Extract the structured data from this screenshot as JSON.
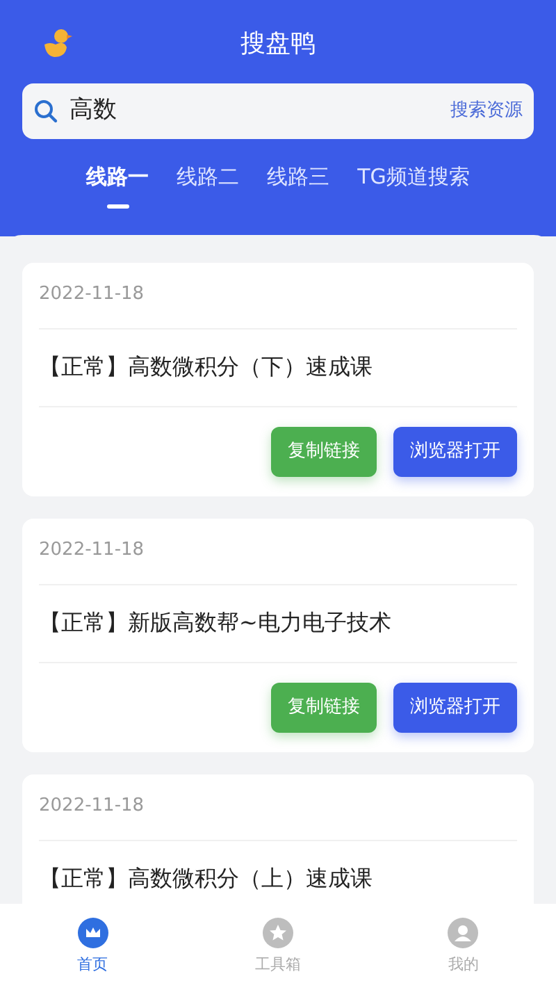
{
  "app": {
    "title": "搜盘鸭"
  },
  "search": {
    "value": "高数",
    "action": "搜索资源"
  },
  "tabs": [
    {
      "label": "线路一",
      "selected": true
    },
    {
      "label": "线路二",
      "selected": false
    },
    {
      "label": "线路三",
      "selected": false
    },
    {
      "label": "TG频道搜索",
      "selected": false
    }
  ],
  "results": [
    {
      "date": "2022-11-18",
      "title": "【正常】高数微积分（下）速成课",
      "buttons": [
        {
          "label": "复制链接",
          "kind": "copy"
        },
        {
          "label": "浏览器打开",
          "kind": "open"
        }
      ]
    },
    {
      "date": "2022-11-18",
      "title": "【正常】新版高数帮~电力电子技术",
      "buttons": [
        {
          "label": "复制链接",
          "kind": "copy"
        },
        {
          "label": "浏览器打开",
          "kind": "open"
        }
      ]
    },
    {
      "date": "2022-11-18",
      "title": "【正常】高数微积分（上）速成课"
    }
  ],
  "bottom_nav": [
    {
      "label": "首页",
      "kind": "home",
      "selected": true
    },
    {
      "label": "工具箱",
      "kind": "tools",
      "selected": false
    },
    {
      "label": "我的",
      "kind": "me",
      "selected": false
    }
  ]
}
